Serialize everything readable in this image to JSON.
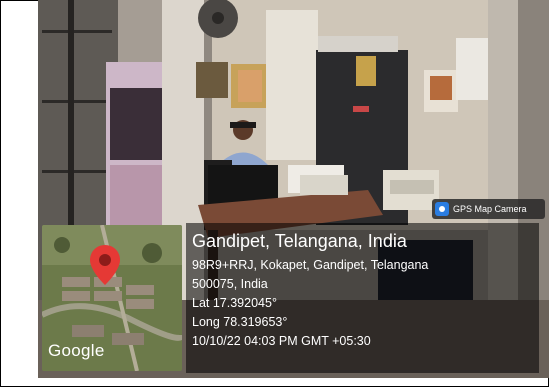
{
  "badge": {
    "label": "GPS Map Camera",
    "icon": "gps-camera-icon"
  },
  "location": {
    "title": "Gandipet, Telangana, India",
    "address_line1": "98R9+RRJ, Kokapet, Gandipet, Telangana",
    "address_line2": "500075, India",
    "lat": "Lat 17.392045°",
    "long": "Long 78.319653°",
    "timestamp": "10/10/22 04:03 PM GMT +05:30"
  },
  "map": {
    "attribution": "Google",
    "pin_color": "#e53935"
  }
}
